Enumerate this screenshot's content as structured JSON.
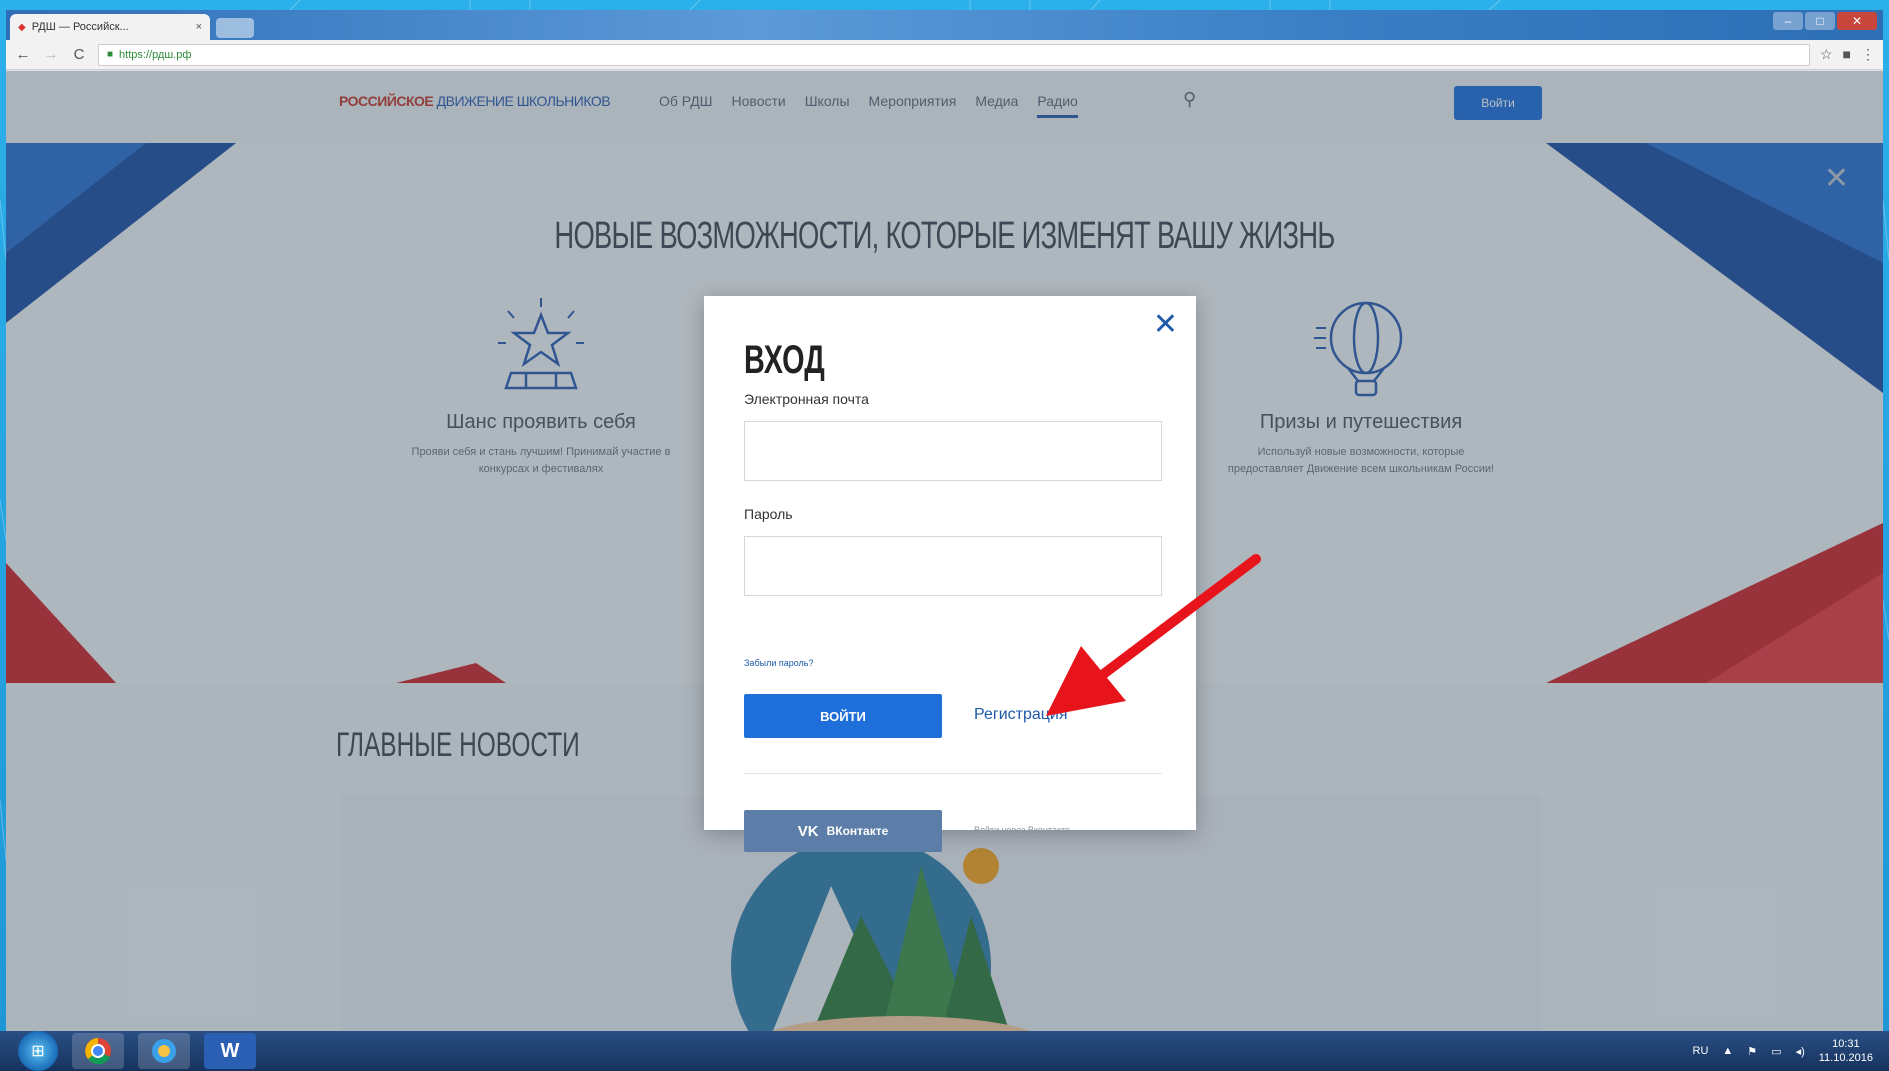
{
  "browser": {
    "tab_title": "РДШ — Российск...",
    "tab_close": "×",
    "url": "https://рдш.рф"
  },
  "site": {
    "logo_red": "РОССИЙСКОЕ",
    "logo_blue": "ДВИЖЕНИЕ ШКОЛЬНИКОВ",
    "nav": [
      "Об РДШ",
      "Новости",
      "Школы",
      "Мероприятия",
      "Медиа",
      "Радио"
    ],
    "login_label": "Войти"
  },
  "hero": {
    "title": "НОВЫЕ ВОЗМОЖНОСТИ, КОТОРЫЕ ИЗМЕНЯТ ВАШУ ЖИЗНЬ",
    "feature_left": {
      "title": "Шанс проявить себя",
      "desc_line1": "Прояви себя и стань лучшим! Принимай участие в",
      "desc_line2": "конкурсах и фестивалях"
    },
    "feature_right": {
      "title": "Призы и путешествия",
      "desc_line1": "Используй новые возможности, которые",
      "desc_line2": "предоставляет Движение всем школьникам России!"
    }
  },
  "news": {
    "title": "ГЛАВНЫЕ НОВОСТИ"
  },
  "modal": {
    "title": "ВХОД",
    "email_label": "Электронная почта",
    "email_value": "",
    "password_label": "Пароль",
    "password_value": "",
    "forgot_label": "Забыли пароль?",
    "submit_label": "ВОЙТИ",
    "register_label": "Регистрация",
    "vk_logo": "VK",
    "vk_button_label": "ВКонтакте",
    "vk_text": "Войти через Вконтакте"
  },
  "taskbar": {
    "lang": "RU",
    "time": "10:31",
    "date": "11.10.2016",
    "word_icon_label": "W"
  },
  "colors": {
    "primary_blue": "#1e6fd9",
    "vk_blue": "#5b7da8",
    "arrow_red": "#e8141b"
  },
  "icons": {
    "search": "search-icon",
    "close": "close-icon",
    "star": "star-icon",
    "balloon": "balloon-icon"
  }
}
